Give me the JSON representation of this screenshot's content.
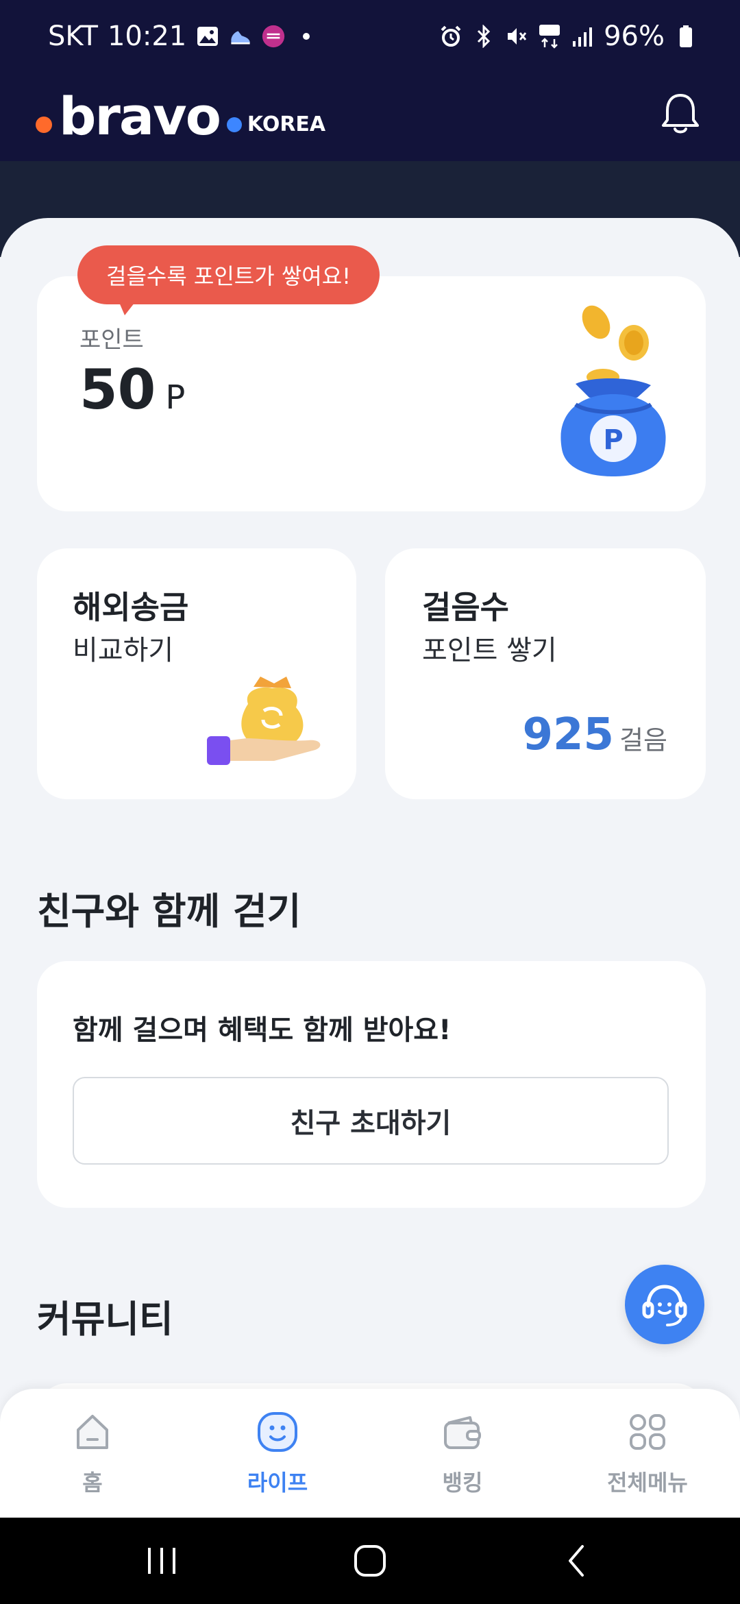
{
  "status_bar": {
    "carrier": "SKT",
    "time": "10:21",
    "battery": "96%"
  },
  "app_bar": {
    "logo_word": "bravo",
    "logo_region": "KOREA"
  },
  "points": {
    "tooltip": "걸을수록 포인트가 쌓여요!",
    "label": "포인트",
    "value": "50",
    "unit": "P",
    "bag_letter": "P"
  },
  "remit": {
    "title": "해외송금",
    "subtitle": "비교하기"
  },
  "walk": {
    "title": "걸음수",
    "subtitle": "포인트 쌓기",
    "steps": "925",
    "steps_unit": "걸음"
  },
  "friends": {
    "section_title": "친구와 함께 걷기",
    "headline": "함께 걸으며 혜택도 함께 받아요!",
    "invite_label": "친구 초대하기"
  },
  "community": {
    "section_title": "커뮤니티"
  },
  "tabs": [
    {
      "label": "홈",
      "active": false
    },
    {
      "label": "라이프",
      "active": true
    },
    {
      "label": "뱅킹",
      "active": false
    },
    {
      "label": "전체메뉴",
      "active": false
    }
  ],
  "colors": {
    "header_bg": "#12133a",
    "accent_blue": "#3e82f2",
    "tooltip_red": "#ea5a4c",
    "steps_blue": "#3b77d6"
  }
}
